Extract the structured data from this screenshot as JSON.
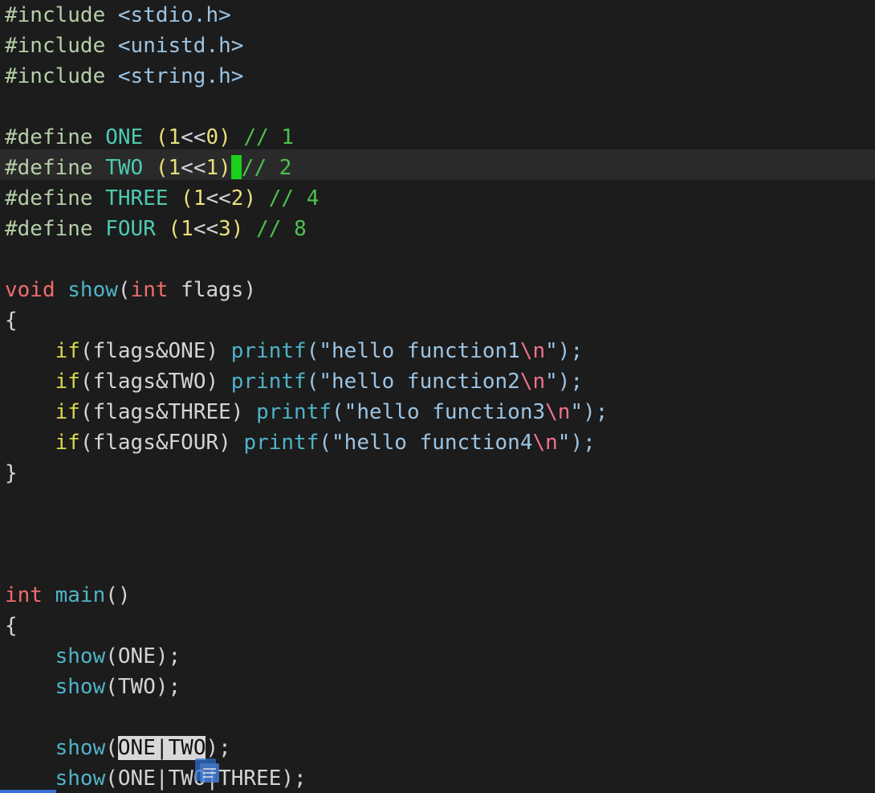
{
  "editor": {
    "includes": [
      {
        "directive": "#include",
        "header": "<stdio.h>"
      },
      {
        "directive": "#include",
        "header": "<unistd.h>"
      },
      {
        "directive": "#include",
        "header": "<string.h>"
      }
    ],
    "defines": [
      {
        "directive": "#define",
        "name": "ONE",
        "open": "(",
        "one": "1",
        "shift": "<<",
        "bit": "0",
        "close": ")",
        "comment": "// 1"
      },
      {
        "directive": "#define",
        "name": "TWO",
        "open": "(",
        "one": "1",
        "shift": "<<",
        "bit": "1",
        "close": ")",
        "comment": "// 2"
      },
      {
        "directive": "#define",
        "name": "THREE",
        "open": "(",
        "one": "1",
        "shift": "<<",
        "bit": "2",
        "close": ")",
        "comment": "// 4"
      },
      {
        "directive": "#define",
        "name": "FOUR",
        "open": "(",
        "one": "1",
        "shift": "<<",
        "bit": "3",
        "close": ")",
        "comment": "// 8"
      }
    ],
    "show_func": {
      "ret_type": "void",
      "name": "show",
      "open_paren": "(",
      "param_type": "int",
      "param_name": " flags",
      "close_paren": ")",
      "open_brace": "{",
      "close_brace": "}",
      "body": [
        {
          "kw": "if",
          "cond": "(flags&ONE)",
          "call": "printf",
          "open": "(\"",
          "text": "hello function1",
          "esc": "\\n",
          "close": "\");"
        },
        {
          "kw": "if",
          "cond": "(flags&TWO)",
          "call": "printf",
          "open": "(\"",
          "text": "hello function2",
          "esc": "\\n",
          "close": "\");"
        },
        {
          "kw": "if",
          "cond": "(flags&THREE)",
          "call": "printf",
          "open": "(\"",
          "text": "hello function3",
          "esc": "\\n",
          "close": "\");"
        },
        {
          "kw": "if",
          "cond": "(flags&FOUR)",
          "call": "printf",
          "open": "(\"",
          "text": "hello function4",
          "esc": "\\n",
          "close": "\");"
        }
      ]
    },
    "main_func": {
      "ret_type": "int",
      "name": "main",
      "parens": "()",
      "open_brace": "{",
      "calls": [
        {
          "fn": "show",
          "args": "(ONE);"
        },
        {
          "fn": "show",
          "args": "(TWO);"
        }
      ],
      "selected_call": {
        "fn": "show",
        "open": "(",
        "selected": "ONE|TWO",
        "close": ");"
      },
      "last_call": {
        "fn": "show",
        "args": "(ONE|TWO|THREE);"
      }
    },
    "colors": {
      "background": "#1c1c1c",
      "cursor": "#19d219",
      "selection": "#d8d8d8"
    }
  }
}
